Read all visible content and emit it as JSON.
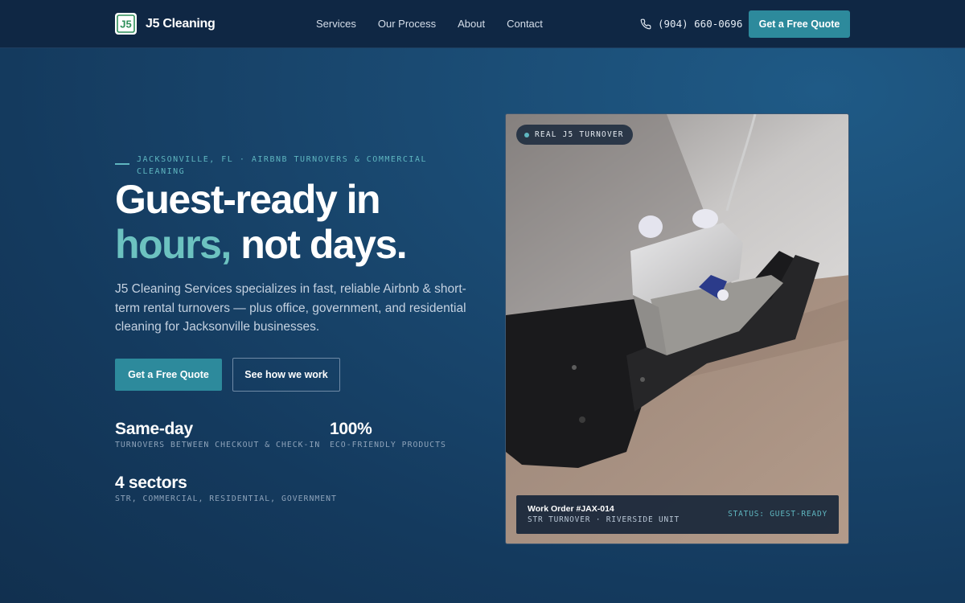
{
  "brand": {
    "name": "J5 Cleaning",
    "mark": "J5"
  },
  "nav": {
    "links": [
      "Services",
      "Our Process",
      "About",
      "Contact"
    ],
    "phone": "(904) 660-0696",
    "cta": "Get a Free Quote"
  },
  "hero": {
    "eyebrow": "JACKSONVILLE, FL · AIRBNB TURNOVERS & COMMERCIAL CLEANING",
    "headline_line1": "Guest-ready in",
    "headline_accent": "hours,",
    "headline_rest": " not days.",
    "lede": "J5 Cleaning Services specializes in fast, reliable Airbnb & short-term rental turnovers — plus office, government, and residential cleaning for Jacksonville businesses.",
    "primary_cta": "Get a Free Quote",
    "secondary_cta": "See how we work"
  },
  "stats": [
    {
      "value": "Same-day",
      "label": "TURNOVERS BETWEEN CHECKOUT & CHECK-IN"
    },
    {
      "value": "100%",
      "label": "ECO-FRIENDLY PRODUCTS"
    },
    {
      "value": "4 sectors",
      "label": "STR, COMMERCIAL, RESIDENTIAL, GOVERNMENT"
    }
  ],
  "photo": {
    "badge": "REAL J5 TURNOVER",
    "work_order_title": "Work Order #JAX-014",
    "work_order_sub": "STR TURNOVER · RIVERSIDE UNIT",
    "status": "STATUS: GUEST-READY"
  },
  "colors": {
    "accent": "#2d8a9c",
    "accent_text": "#6cc2c0",
    "nav_bg": "#0f2744"
  },
  "icons": {
    "phone": "phone-icon"
  }
}
